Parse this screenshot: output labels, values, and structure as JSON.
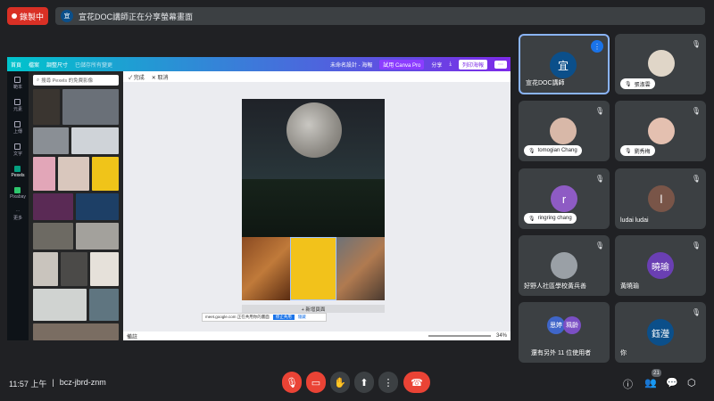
{
  "recording": {
    "label": "錄製中"
  },
  "presenter_bar": {
    "avatar": "宜",
    "text": "宣花DOC講師正在分享螢幕畫面"
  },
  "canva": {
    "home": "首頁",
    "file": "檔案",
    "resize": "調整尺寸",
    "saved": "已儲存所有變更",
    "doc_title": "未命名設計 - 海報",
    "try_pro": "試用 Canva Pro",
    "share": "分享",
    "print": "列印海報",
    "done": "完成",
    "cancel": "取消",
    "search_placeholder": "搜尋 Pexels 的免費影像",
    "rail": [
      "範本",
      "元素",
      "上傳",
      "文字",
      "Pexels",
      "Pixabay",
      "更多"
    ],
    "add_page": "+ 新增頁面",
    "notes": "備註",
    "zoom": "34%",
    "toast_text": "meet.google.com 正在共用你的畫面",
    "toast_stop": "停止共用",
    "toast_hide": "隱藏"
  },
  "participants": [
    {
      "name": "宣花DOC講師",
      "initial": "宜",
      "color": "#0b4f8a",
      "active": true
    },
    {
      "name": "張淑雲",
      "initial": "",
      "color": "#e0d6c8"
    },
    {
      "name": "tomogian Chang",
      "initial": "",
      "color": "#d8b8a8"
    },
    {
      "name": "劉秀梅",
      "initial": "",
      "color": "#e4c0b0"
    },
    {
      "name": "ringring chang",
      "initial": "r",
      "color": "#8e5bc4"
    },
    {
      "name": "ludai ludai",
      "initial": "l",
      "color": "#795548"
    },
    {
      "name": "好野人社區學校黃兵善",
      "initial": "",
      "color": "#9aa0a6"
    },
    {
      "name": "黃曉瑜",
      "initial": "曉瑜",
      "color": "#6a3fb3"
    },
    {
      "name": "還有另外 11 位使用者",
      "initial": "思婷",
      "initial2": "珮齡",
      "color": "#3f66c9",
      "color2": "#7b4fc4"
    },
    {
      "name": "你",
      "initial": "鈺瀅",
      "color": "#0b4f8a"
    }
  ],
  "bottom": {
    "time": "11:57 上午",
    "separator": "|",
    "code": "bcz-jbrd-znm",
    "people_count": "21"
  },
  "colors": {
    "end_call": "#ea4335",
    "accent": "#8ab4f8"
  }
}
